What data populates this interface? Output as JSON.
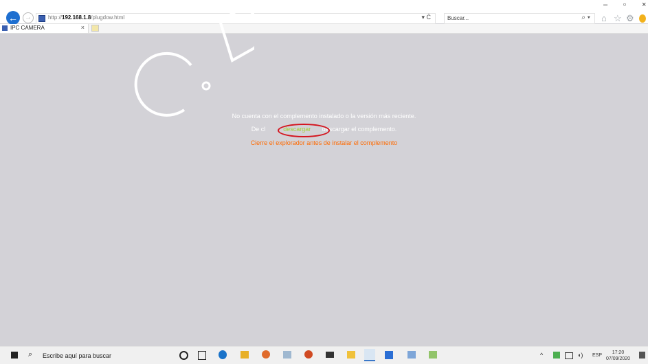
{
  "browser": {
    "url_prefix": "http://",
    "url_host": "192.168.1.8",
    "url_path": "/plugdow.html",
    "search_placeholder": "Buscar...",
    "refresh_label": "▾ Ċ",
    "search_mag": "⌕ ▾",
    "minimize": "–",
    "maximize": "▫",
    "close": "×",
    "home": "⌂",
    "star": "☆",
    "gear": "⚙"
  },
  "tab": {
    "label": "IPC CAMERA",
    "close": "×"
  },
  "message": {
    "line1": "No cuenta con el complemento instalado o la versión más reciente.",
    "line2_start": "De cl",
    "line2_link": "descargar",
    "line2_end": " descargar el complemento.",
    "line3": "Cierre el explorador antes de instalar el complemento"
  },
  "watermark": {
    "text": "C.D."
  },
  "taskbar": {
    "search_placeholder": "Escribe aquí para buscar",
    "lang": "ESP",
    "time": "17:20",
    "date": "07/09/2020"
  }
}
